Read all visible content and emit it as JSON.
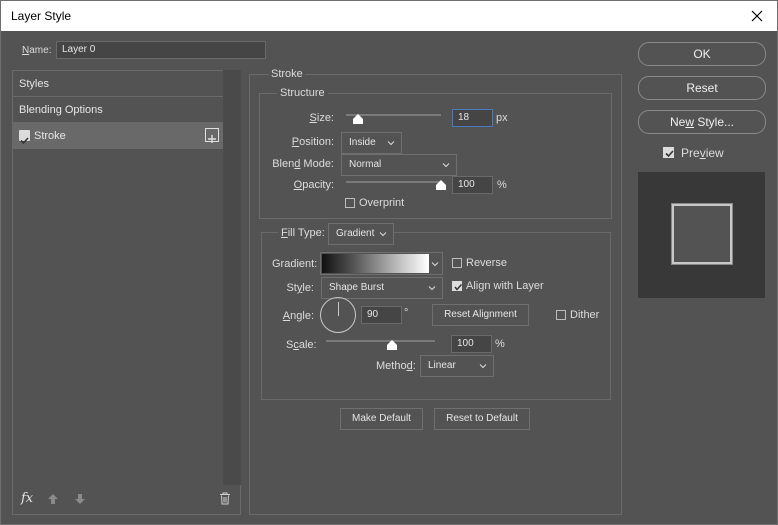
{
  "window": {
    "title": "Layer Style"
  },
  "name_field": {
    "label": "Name:",
    "value": "Layer 0"
  },
  "sidebar": {
    "items": [
      {
        "label": "Styles"
      },
      {
        "label": "Blending Options"
      },
      {
        "label": "Stroke",
        "checked": true,
        "selected": true
      }
    ],
    "footer": {
      "fx_label": "fx"
    }
  },
  "stroke": {
    "group_title": "Stroke",
    "structure": {
      "title": "Structure",
      "size_label": "Size:",
      "size_value": "18",
      "size_unit": "px",
      "size_slider_fraction": 0.12,
      "position_label": "Position:",
      "position_value": "Inside",
      "blend_mode_label": "Blend Mode:",
      "blend_mode_value": "Normal",
      "opacity_label": "Opacity:",
      "opacity_value": "100",
      "opacity_unit": "%",
      "opacity_slider_fraction": 1.0,
      "overprint_label": "Overprint",
      "overprint_checked": false
    },
    "fill": {
      "fill_type_label": "Fill Type:",
      "fill_type_value": "Gradient",
      "gradient_label": "Gradient:",
      "reverse_label": "Reverse",
      "reverse_checked": false,
      "style_label": "Style:",
      "style_value": "Shape Burst",
      "align_label": "Align with Layer",
      "align_checked": true,
      "angle_label": "Angle:",
      "angle_value": "90",
      "angle_unit": "°",
      "reset_alignment_label": "Reset Alignment",
      "dither_label": "Dither",
      "dither_checked": false,
      "scale_label": "Scale:",
      "scale_value": "100",
      "scale_unit": "%",
      "scale_slider_fraction": 0.6,
      "method_label": "Method:",
      "method_value": "Linear"
    },
    "make_default_label": "Make Default",
    "reset_to_default_label": "Reset to Default"
  },
  "actions": {
    "ok_label": "OK",
    "reset_label": "Reset",
    "new_style_label": "New Style...",
    "preview_label": "Preview",
    "preview_checked": true
  },
  "colors": {
    "dialog_bg": "#535353",
    "border": "#6a6a6a",
    "focus_border": "#4b7bbf",
    "text": "#dcdcdc"
  }
}
